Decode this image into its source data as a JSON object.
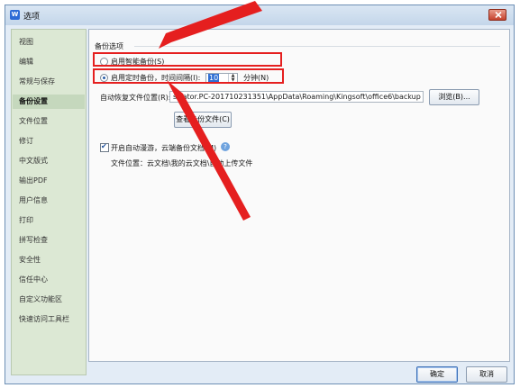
{
  "window": {
    "title": "选项",
    "app_icon": "W"
  },
  "sidebar": {
    "items": [
      {
        "label": "视图"
      },
      {
        "label": "编辑"
      },
      {
        "label": "常规与保存"
      },
      {
        "label": "备份设置",
        "active": true
      },
      {
        "label": "文件位置"
      },
      {
        "label": "修订"
      },
      {
        "label": "中文版式"
      },
      {
        "label": "输出PDF"
      },
      {
        "label": "用户信息"
      },
      {
        "label": "打印"
      },
      {
        "label": "拼写检查"
      },
      {
        "label": "安全性"
      },
      {
        "label": "信任中心"
      },
      {
        "label": "自定义功能区"
      },
      {
        "label": "快速访问工具栏"
      }
    ]
  },
  "backup": {
    "group_title": "备份选项",
    "smart_backup_label": "启用智能备份(S)",
    "timed_backup_label": "启用定时备份，时间间隔(I):",
    "interval_value": "10",
    "interval_unit": "分钟(N)",
    "restore_location_label": "自动恢复文件位置(R):",
    "restore_path": "strator.PC-201710231351\\AppData\\Roaming\\Kingsoft\\office6\\backup",
    "browse_label": "浏览(B)...",
    "view_backup_label": "查看备份文件(C)",
    "roaming_label": "开启自动漫游，云端备份文档(M)",
    "file_location_text": "文件位置：云文档\\我的云文档\\自动上传文件"
  },
  "footer": {
    "ok_label": "确定",
    "cancel_label": "取消"
  },
  "colors": {
    "annotation": "#e51f1f",
    "accent": "#2f6fd4"
  }
}
